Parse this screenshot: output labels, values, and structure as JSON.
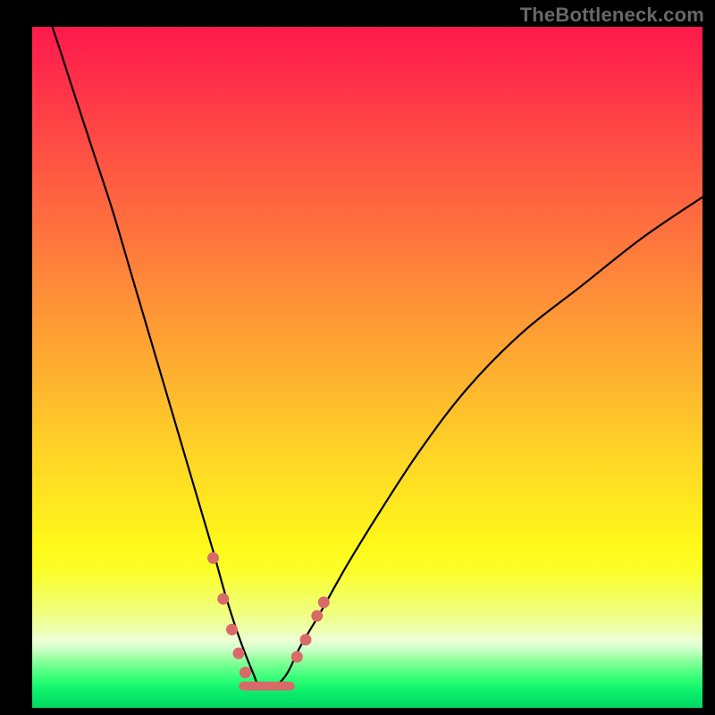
{
  "watermark": "TheBottleneck.com",
  "colors": {
    "background": "#000000",
    "curve": "#000000",
    "markers": "#d96a6a",
    "gradient_top": "#ff1a4d",
    "gradient_bottom": "#04d963"
  },
  "chart_data": {
    "type": "line",
    "title": "",
    "xlabel": "",
    "ylabel": "",
    "xlim": [
      0,
      100
    ],
    "ylim": [
      0,
      100
    ],
    "note": "No axes or tick labels are rendered; x and y are normalized 0–100 across the visible plot area. The curve is a V-shaped bottleneck profile with its minimum near x≈34 at y≈3.",
    "series": [
      {
        "name": "bottleneck-curve",
        "x": [
          0,
          3,
          6,
          9,
          12,
          15,
          18,
          21,
          24,
          27,
          29,
          31,
          33,
          34,
          36,
          38,
          40,
          43,
          47,
          52,
          58,
          65,
          73,
          82,
          91,
          100
        ],
        "y": [
          108,
          100,
          91,
          82,
          73,
          63,
          53,
          43,
          33,
          23,
          16,
          10,
          5,
          3,
          3,
          5,
          9,
          14,
          21,
          29,
          38,
          47,
          55,
          62,
          69,
          75
        ]
      }
    ],
    "markers": {
      "name": "highlight-dots",
      "points": [
        {
          "x": 27.0,
          "y": 22.0
        },
        {
          "x": 28.5,
          "y": 16.0
        },
        {
          "x": 29.8,
          "y": 11.5
        },
        {
          "x": 30.8,
          "y": 8.0
        },
        {
          "x": 31.8,
          "y": 5.2
        },
        {
          "x": 39.5,
          "y": 7.5
        },
        {
          "x": 40.8,
          "y": 10.0
        },
        {
          "x": 42.5,
          "y": 13.5
        },
        {
          "x": 43.5,
          "y": 15.5
        }
      ],
      "baseline": {
        "x0": 31.5,
        "x1": 38.5,
        "y": 3.2
      }
    }
  }
}
